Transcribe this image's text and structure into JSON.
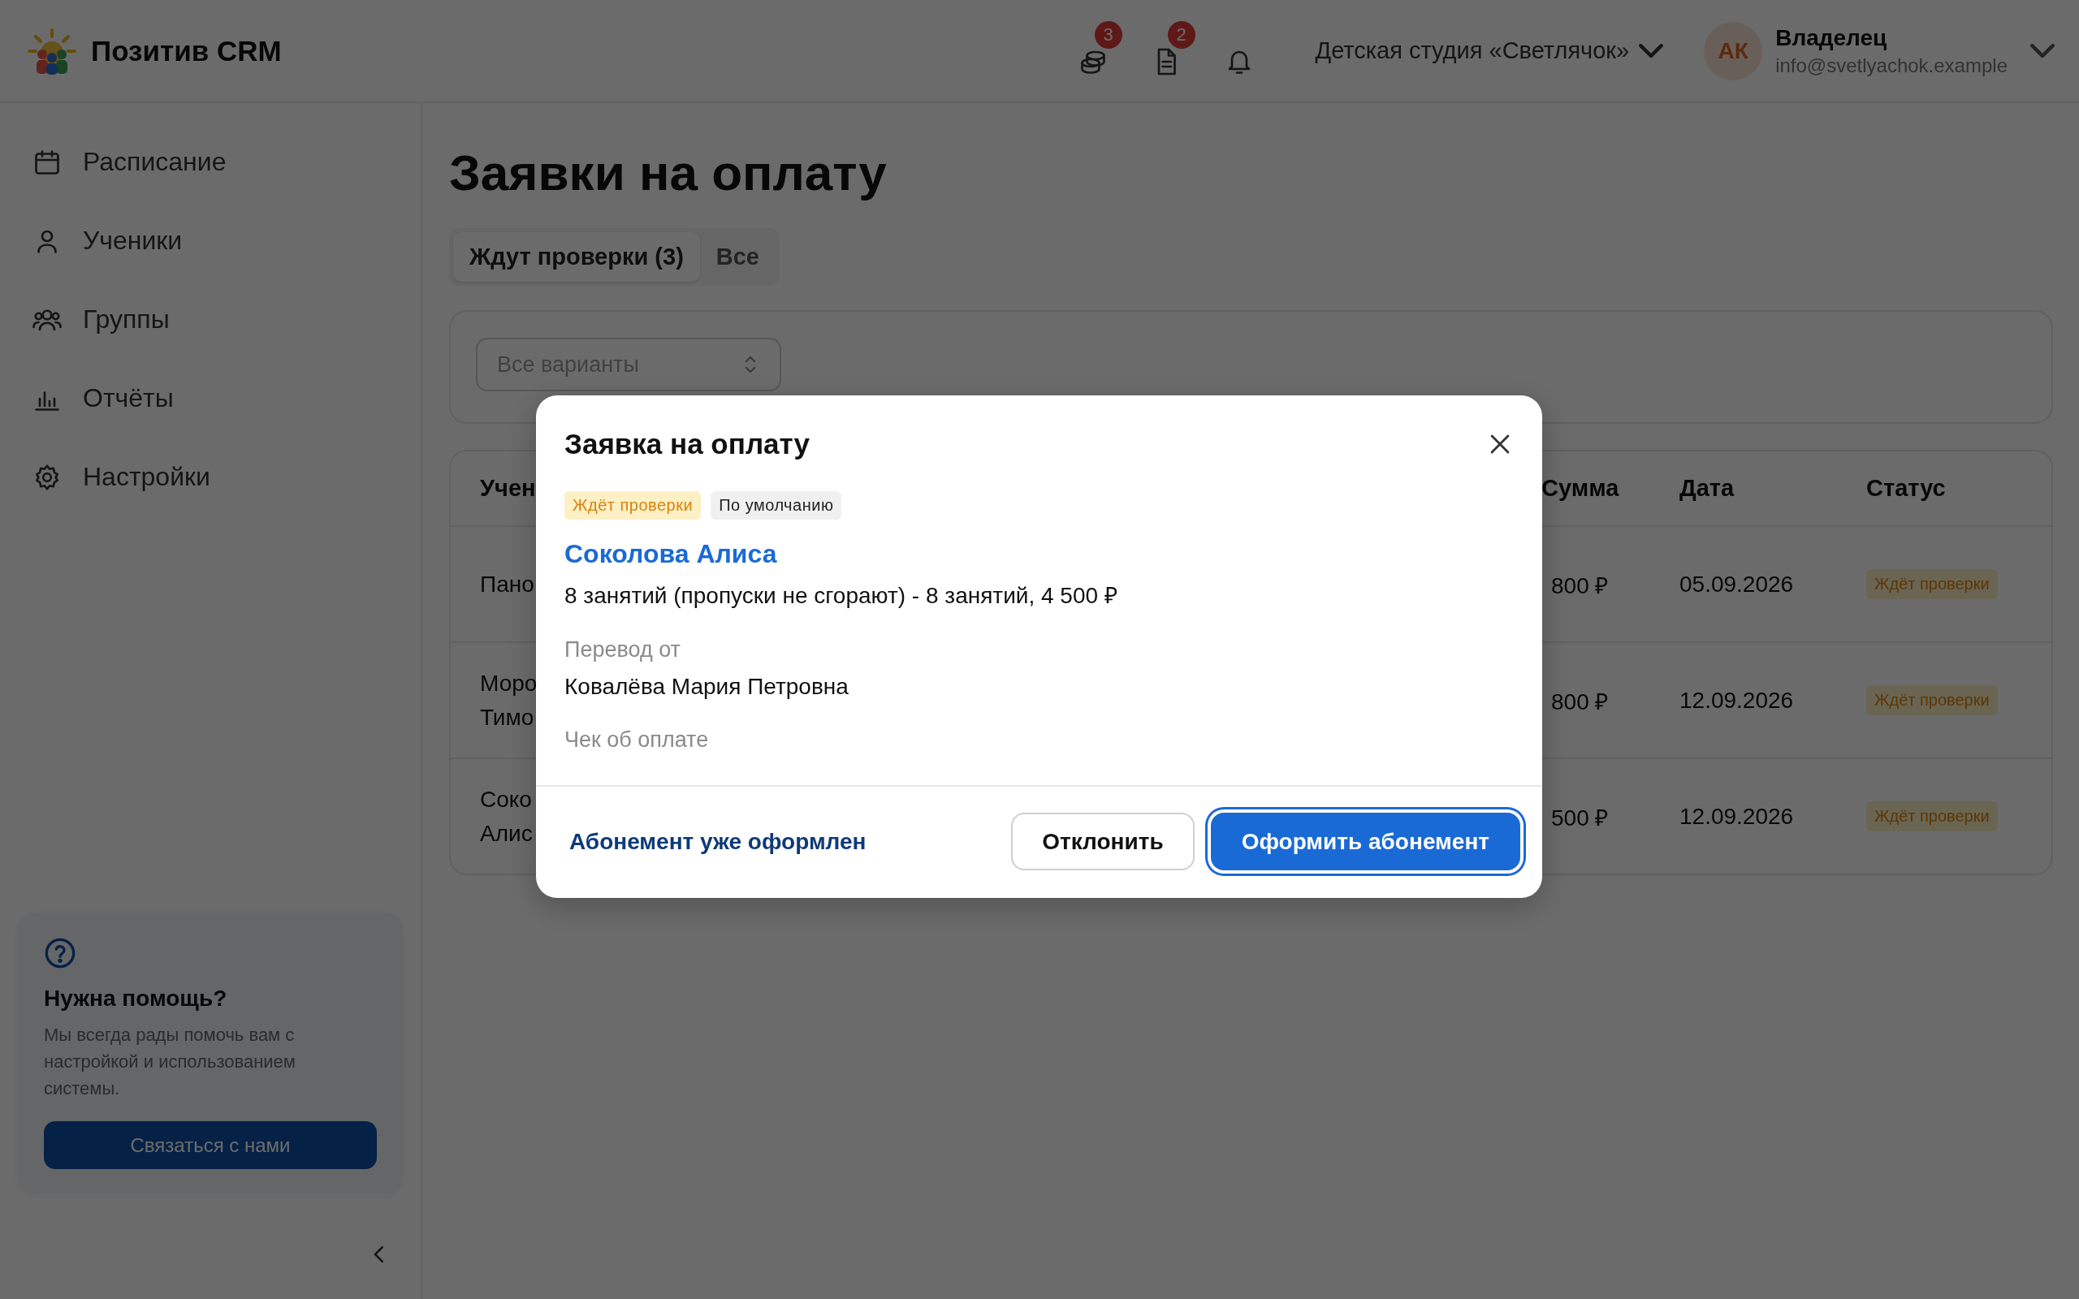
{
  "header": {
    "logo_text": "Позитив CRM",
    "icons": [
      {
        "kind": "coins",
        "badge": "3"
      },
      {
        "kind": "document",
        "badge": "2"
      },
      {
        "kind": "bell"
      }
    ],
    "studio": "Детская студия «Светлячок»",
    "user": {
      "initials": "АК",
      "role": "Владелец",
      "email": "info@svetlyachok.example"
    }
  },
  "sidebar": {
    "items": [
      {
        "label": "Расписание"
      },
      {
        "label": "Ученики"
      },
      {
        "label": "Группы"
      },
      {
        "label": "Отчёты"
      },
      {
        "label": "Настройки"
      }
    ],
    "help": {
      "title": "Нужна помощь?",
      "text": "Мы всегда рады помочь вам с настройкой и использованием системы.",
      "button": "Связаться с нами"
    }
  },
  "page": {
    "title": "Заявки на оплату",
    "tabs": [
      {
        "label": "Ждут проверки (3)",
        "selected": true
      },
      {
        "label": "Все",
        "selected": false
      }
    ],
    "filter": {
      "placeholder": "Все варианты"
    },
    "table": {
      "columns": [
        "Учен",
        "Сумма",
        "Дата",
        "Статус"
      ],
      "rows": [
        {
          "student_lines": [
            "Пано"
          ],
          "amount": "800 ₽",
          "date": "05.09.2026",
          "status": "Ждёт проверки"
        },
        {
          "student_lines": [
            "Моро",
            "Тимо"
          ],
          "amount": "800 ₽",
          "date": "12.09.2026",
          "status": "Ждёт проверки"
        },
        {
          "student_lines": [
            "Соко",
            "Алис"
          ],
          "amount": "500 ₽",
          "date": "12.09.2026",
          "status": "Ждёт проверки"
        }
      ]
    }
  },
  "modal": {
    "title": "Заявка на оплату",
    "badges": [
      {
        "kind": "status",
        "text": "Ждёт проверки"
      },
      {
        "kind": "tag",
        "text": "По умолчанию"
      }
    ],
    "student": "Соколова Алиса",
    "plan": "8 занятий (пропуски не сгорают) - 8 занятий, 4 500 ₽",
    "fields": [
      {
        "label": "Перевод от",
        "value": "Ковалёва Мария Петровна"
      },
      {
        "label": "Чек об оплате"
      }
    ],
    "buttons": [
      {
        "kind": "link",
        "label": "Абонемент уже оформлен",
        "focused": false
      },
      {
        "kind": "secondary",
        "label": "Отклонить",
        "focused": false
      },
      {
        "kind": "primary",
        "label": "Оформить абонемент",
        "focused": true
      }
    ]
  }
}
